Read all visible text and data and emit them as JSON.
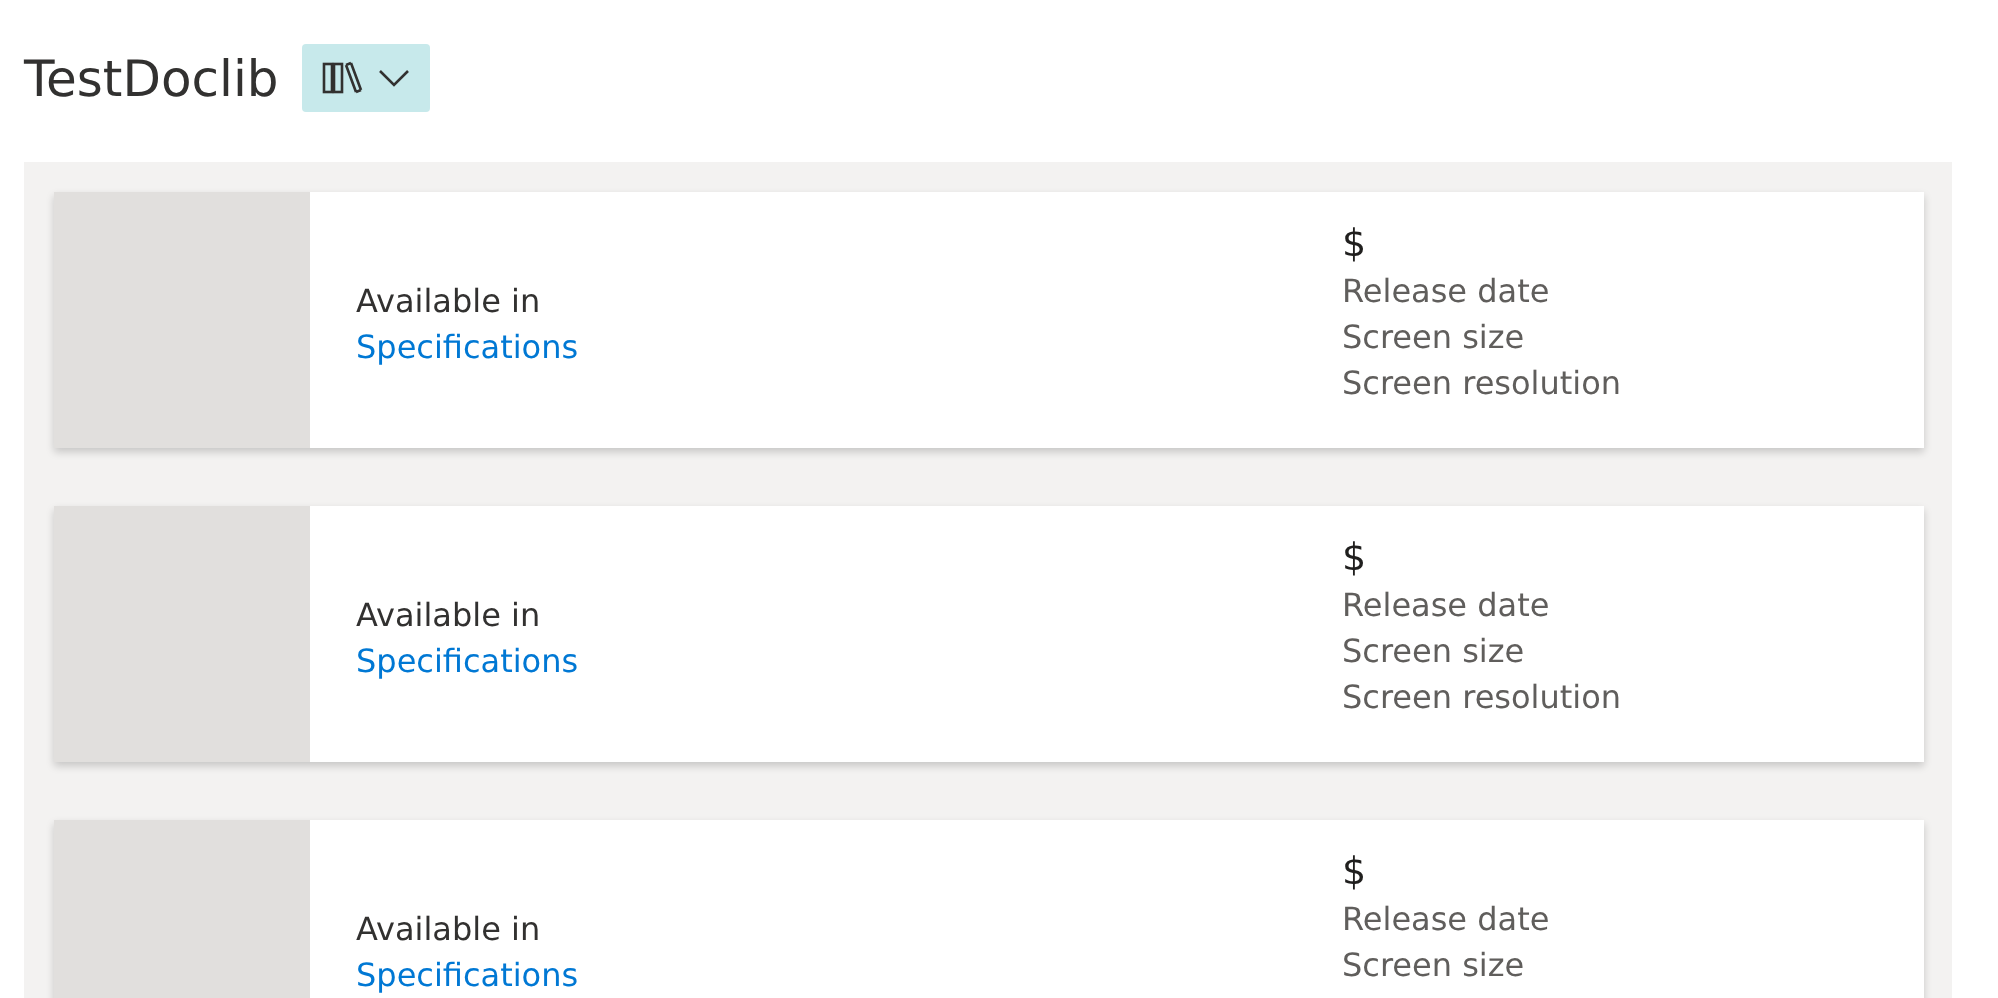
{
  "header": {
    "title": "TestDoclib"
  },
  "cards": [
    {
      "label": "Available in",
      "link": "Specifications",
      "price": "$",
      "details": [
        "Release date",
        "Screen size",
        "Screen resolution"
      ]
    },
    {
      "label": "Available in",
      "link": "Specifications",
      "price": "$",
      "details": [
        "Release date",
        "Screen size",
        "Screen resolution"
      ]
    },
    {
      "label": "Available in",
      "link": "Specifications",
      "price": "$",
      "details": [
        "Release date",
        "Screen size"
      ]
    }
  ]
}
